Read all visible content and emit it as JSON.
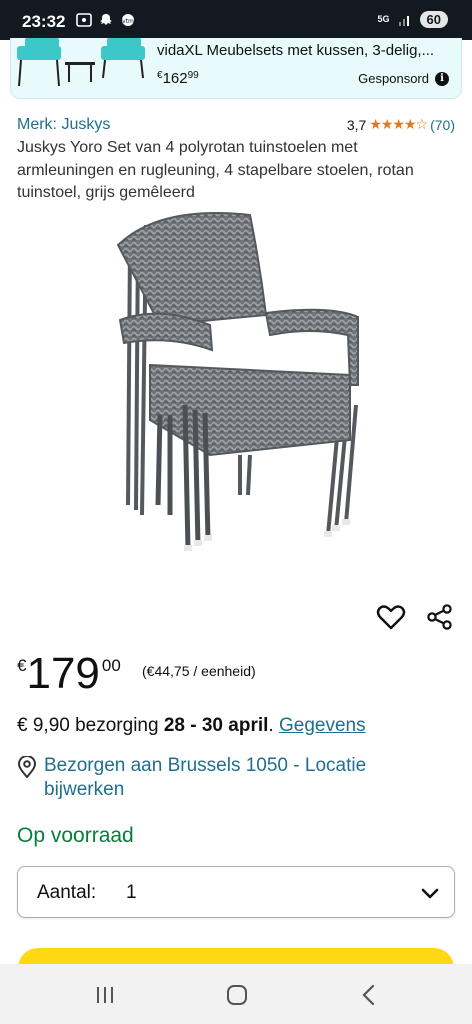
{
  "status_bar": {
    "time": "23:32",
    "network": "5G",
    "battery": "60"
  },
  "ad": {
    "title": "vidaXL Meubelsets met kussen, 3-delig,...",
    "price_currency": "€",
    "price_whole": "162",
    "price_cents": "99",
    "sponsored_label": "Gesponsord",
    "info_icon": "i",
    "accent_color": "#3cc7c9"
  },
  "product": {
    "brand": "Merk: Juskys",
    "rating_value": "3,7",
    "rating_stars": "★★★★☆",
    "rating_count": "(70)",
    "title": "Juskys Yoro Set van 4 polyrotan tuinstoelen met armleuningen en rugleuning, 4 stapelbare stoelen, rotan tuinstoel, grijs gemêleerd",
    "image_icon": "stacked-rattan-chairs-image"
  },
  "actions": {
    "wishlist_icon": "heart-icon",
    "share_icon": "share-icon"
  },
  "price": {
    "currency": "€",
    "whole": "179",
    "cents": "00",
    "unit_price": "(€44,75 / eenheid)"
  },
  "delivery": {
    "prefix": "€ 9,90 bezorging ",
    "dates": "28 - 30 april",
    "dot": ". ",
    "details_link": "Gegevens"
  },
  "location": {
    "text": "Bezorgen aan Brussels 1050 - Locatie bijwerken"
  },
  "stock": {
    "text": "Op voorraad",
    "color": "#067d3a"
  },
  "quantity": {
    "label": "Aantal:",
    "value": "1"
  },
  "buy_button": {
    "color": "#ffd814"
  },
  "colors": {
    "link": "#1f6f8f",
    "star": "#de7921"
  }
}
